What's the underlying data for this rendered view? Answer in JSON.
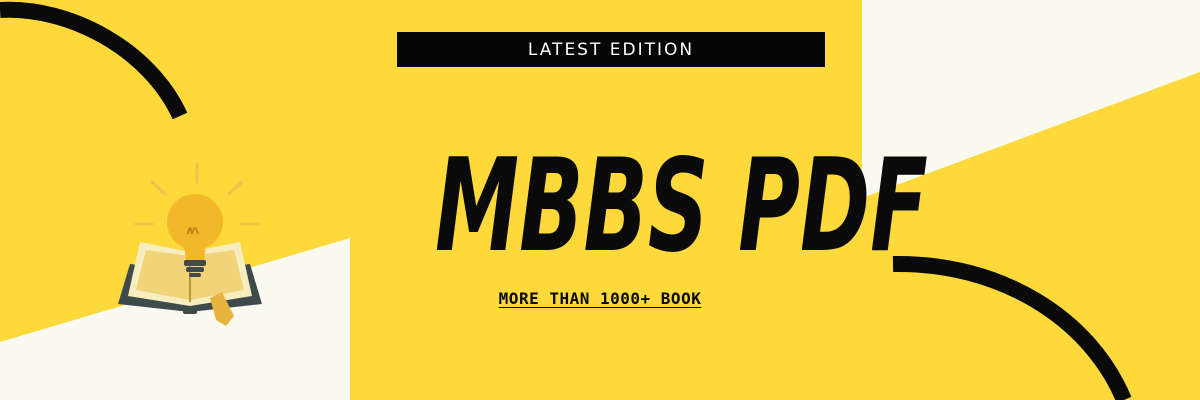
{
  "banner": {
    "badge_text": "LATEST EDITION",
    "title": "MBBS PDF",
    "subtitle": "MORE THAN 1000+ BOOK"
  },
  "colors": {
    "background": "#fdd93b",
    "cream": "#fbfaf0",
    "ink": "#0a0a0a"
  },
  "icons": [
    "lightbulb-icon",
    "open-book-icon",
    "bookmark-icon"
  ]
}
